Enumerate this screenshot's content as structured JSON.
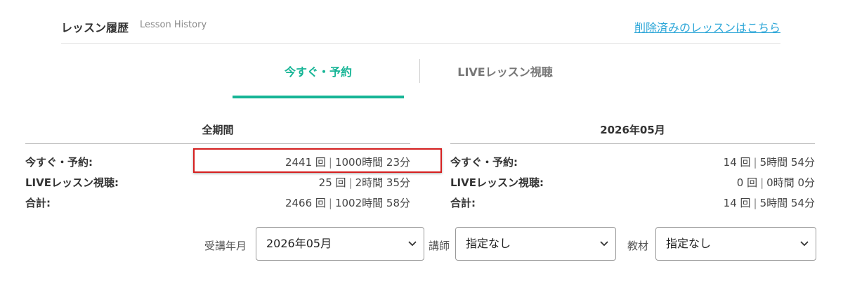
{
  "header": {
    "title": "レッスン履歴",
    "subtitle": "Lesson History",
    "deleted_link": "削除済みのレッスンはこちら"
  },
  "tabs": [
    {
      "label": "今すぐ・予約",
      "active": true
    },
    {
      "label": "LIVEレッスン視聴",
      "active": false
    }
  ],
  "colors": {
    "accent": "#17b596",
    "link": "#2ea7d8",
    "highlight": "#d52020"
  },
  "summary": {
    "all": {
      "heading": "全期間",
      "rows": [
        {
          "label": "今すぐ・予約:",
          "count": "2441 回",
          "time": "1000時間 23分"
        },
        {
          "label": "LIVEレッスン視聴:",
          "count": "25 回",
          "time": "2時間 35分"
        },
        {
          "label": "合計:",
          "count": "2466 回",
          "time": "1002時間 58分"
        }
      ]
    },
    "month": {
      "heading": "2026年05月",
      "rows": [
        {
          "label": "今すぐ・予約:",
          "count": "14 回",
          "time": "5時間 54分"
        },
        {
          "label": "LIVEレッスン視聴:",
          "count": "0 回",
          "time": "0時間 0分"
        },
        {
          "label": "合計:",
          "count": "14 回",
          "time": "5時間 54分"
        }
      ]
    }
  },
  "filters": {
    "month": {
      "label": "受講年月",
      "value": "2026年05月"
    },
    "teacher": {
      "label": "講師",
      "value": "指定なし"
    },
    "material": {
      "label": "教材",
      "value": "指定なし"
    }
  },
  "separator": "|",
  "chevron_icon": "chevron-down-icon"
}
